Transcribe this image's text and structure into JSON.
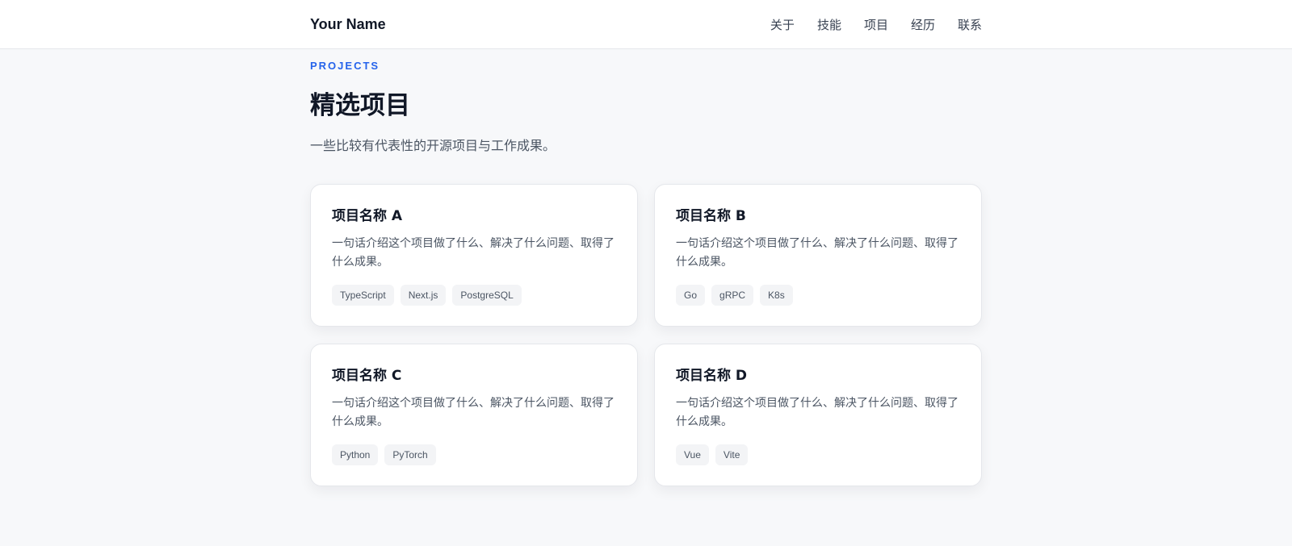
{
  "header": {
    "brand": "Your Name",
    "nav": [
      "关于",
      "技能",
      "项目",
      "经历",
      "联系"
    ]
  },
  "section": {
    "eyebrow": "PROJECTS",
    "title": "精选项目",
    "subtitle": "一些比较有代表性的开源项目与工作成果。"
  },
  "projects": [
    {
      "title": "项目名称 A",
      "description": "一句话介绍这个项目做了什么、解决了什么问题、取得了什么成果。",
      "tags": [
        "TypeScript",
        "Next.js",
        "PostgreSQL"
      ]
    },
    {
      "title": "项目名称 B",
      "description": "一句话介绍这个项目做了什么、解决了什么问题、取得了什么成果。",
      "tags": [
        "Go",
        "gRPC",
        "K8s"
      ]
    },
    {
      "title": "项目名称 C",
      "description": "一句话介绍这个项目做了什么、解决了什么问题、取得了什么成果。",
      "tags": [
        "Python",
        "PyTorch"
      ]
    },
    {
      "title": "项目名称 D",
      "description": "一句话介绍这个项目做了什么、解决了什么问题、取得了什么成果。",
      "tags": [
        "Vue",
        "Vite"
      ]
    }
  ],
  "colors": {
    "accent": "#2563eb",
    "background": "#f7f8fa",
    "card": "#ffffff",
    "tag_bg": "#f3f4f6"
  }
}
